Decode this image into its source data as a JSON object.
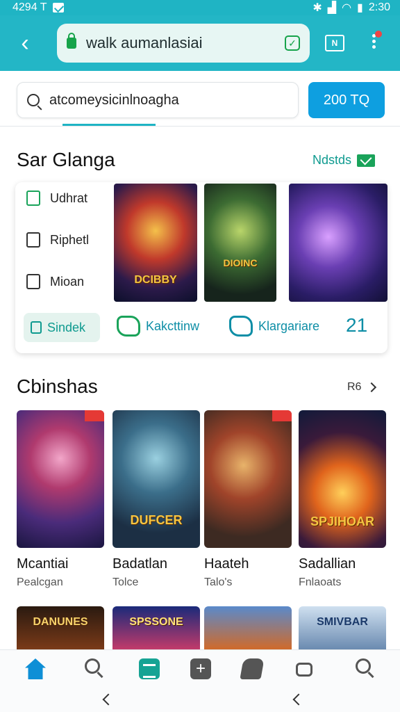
{
  "status_bar": {
    "left_text": "4294 T",
    "time": "2:30"
  },
  "app_bar": {
    "url_text": "walk aumanlasiai",
    "ext_label": "N"
  },
  "search": {
    "query": "atcomeysicinlnoagha",
    "button_label": "200 TQ"
  },
  "section_featured": {
    "title": "Sar Glanga",
    "link_label": "Ndstds",
    "menu": [
      {
        "label": "Udhrat"
      },
      {
        "label": "Riphetl"
      },
      {
        "label": "Mioan"
      }
    ],
    "selected_label": "Sindek",
    "featured_games": [
      {
        "title": "DCIBBY"
      },
      {
        "title": "DIOINC"
      },
      {
        "title": ""
      }
    ],
    "categories": [
      {
        "label": "Kakcttinw"
      },
      {
        "label": "Klargariare"
      }
    ],
    "count": "21"
  },
  "section_games": {
    "title": "Cbinshas",
    "more_label": "R6",
    "games": [
      {
        "name": "Mcantiai",
        "sub": "Pealcgan",
        "art_title": ""
      },
      {
        "name": "Badatlan",
        "sub": "Tolce",
        "art_title": "DUFCER"
      },
      {
        "name": "Haateh",
        "sub": "Talo's",
        "art_title": ""
      },
      {
        "name": "Sadallian",
        "sub": "Fnlaoats",
        "art_title": "SPJIHOAR"
      }
    ],
    "row3_titles": [
      "DANUNES",
      "SPSSONE",
      "",
      "SMIVBAR"
    ]
  },
  "colors": {
    "accent": "#1fb4c4",
    "primary_button": "#0e9fe0",
    "brand_green": "#1aa35a",
    "teal_text": "#0e8ea6"
  }
}
